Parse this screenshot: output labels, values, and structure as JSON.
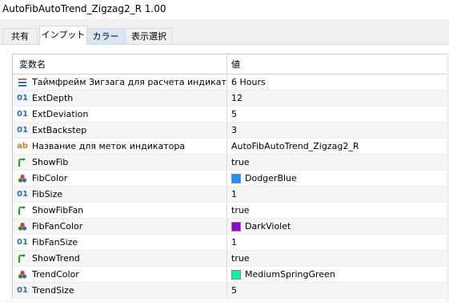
{
  "window": {
    "title": "AutoFibAutoTrend_Zigzag2_R 1.00"
  },
  "tabs": [
    {
      "label": "共有"
    },
    {
      "label": "インプット"
    },
    {
      "label": "カラー"
    },
    {
      "label": "表示選択"
    }
  ],
  "table": {
    "headers": {
      "name": "変数名",
      "value": "値"
    },
    "rows": [
      {
        "icon": "enum-icon",
        "name": "Таймфрейм Зигзага для расчета индикатора",
        "value": "6 Hours"
      },
      {
        "icon": "integer-icon",
        "name": "ExtDepth",
        "value": "12"
      },
      {
        "icon": "integer-icon",
        "name": "ExtDeviation",
        "value": "5"
      },
      {
        "icon": "integer-icon",
        "name": "ExtBackstep",
        "value": "3"
      },
      {
        "icon": "string-icon",
        "name": "Название для меток индикатора",
        "value": "AutoFibAutoTrend_Zigzag2_R"
      },
      {
        "icon": "bool-icon",
        "name": "ShowFib",
        "value": "true"
      },
      {
        "icon": "color-icon",
        "name": "FibColor",
        "value": "DodgerBlue",
        "swatch": "#1e90ff"
      },
      {
        "icon": "integer-icon",
        "name": "FibSize",
        "value": "1"
      },
      {
        "icon": "bool-icon",
        "name": "ShowFibFan",
        "value": "true"
      },
      {
        "icon": "color-icon",
        "name": "FibFanColor",
        "value": "DarkViolet",
        "swatch": "#9400d3"
      },
      {
        "icon": "integer-icon",
        "name": "FibFanSize",
        "value": "1"
      },
      {
        "icon": "bool-icon",
        "name": "ShowTrend",
        "value": "true"
      },
      {
        "icon": "color-icon",
        "name": "TrendColor",
        "value": "MediumSpringGreen",
        "swatch": "#00fa9a"
      },
      {
        "icon": "integer-icon",
        "name": "TrendSize",
        "value": "5"
      }
    ]
  }
}
